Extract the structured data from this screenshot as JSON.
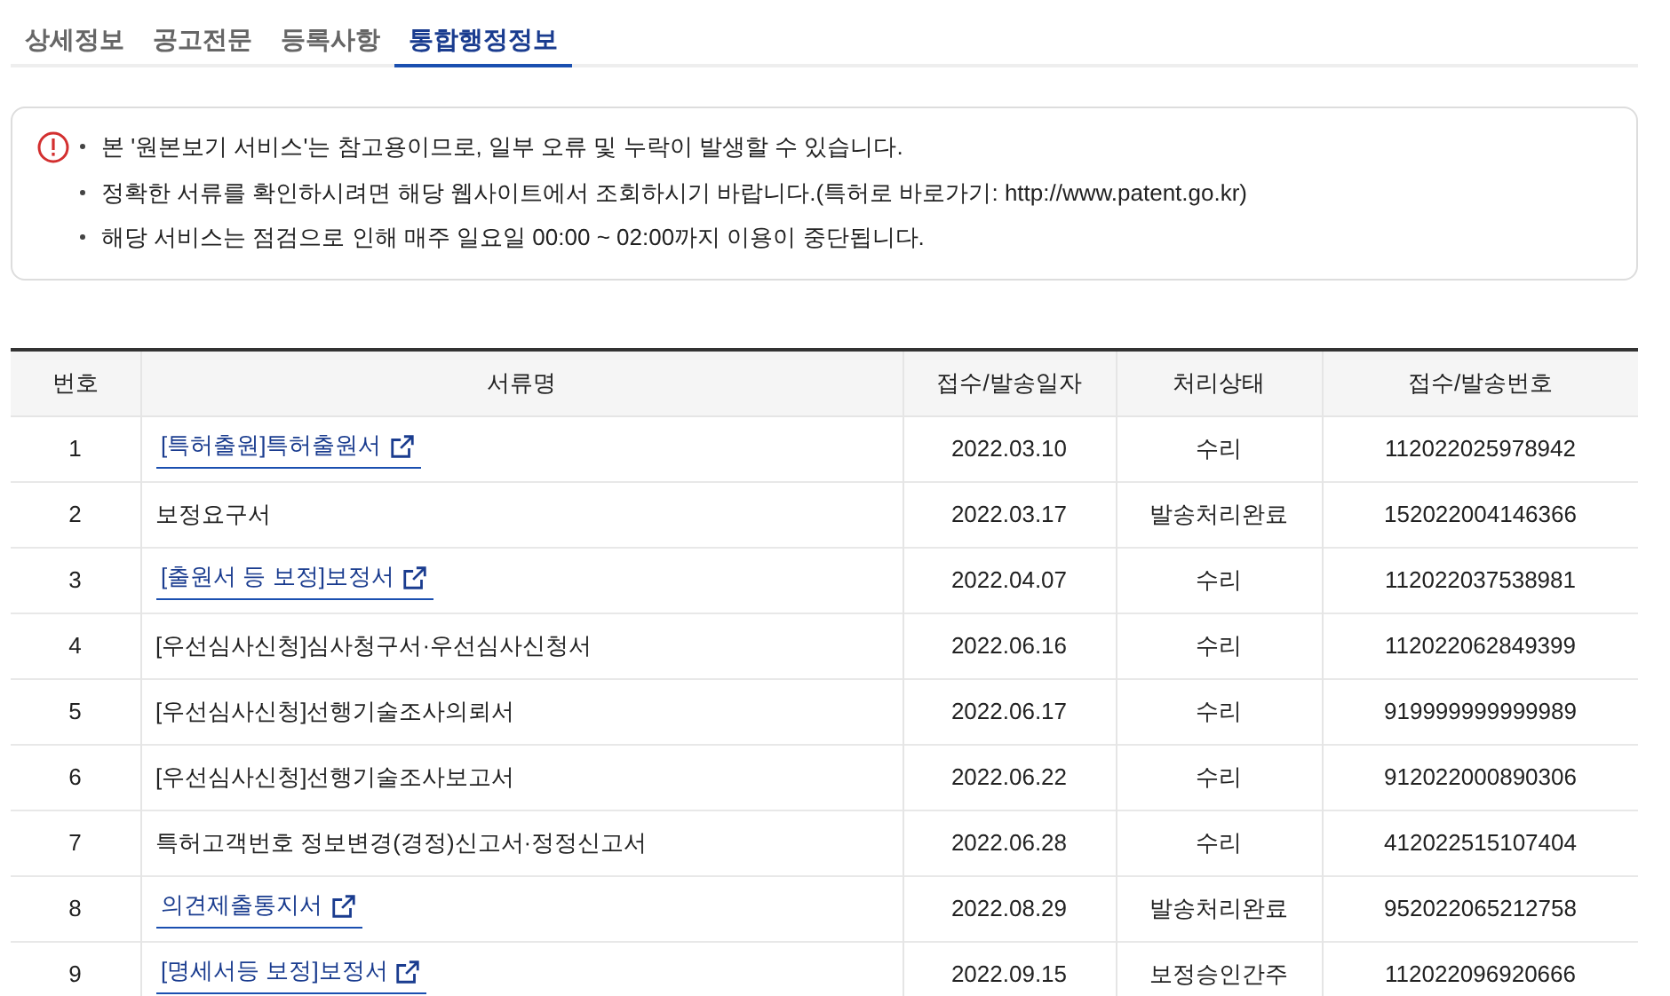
{
  "tabs": [
    {
      "label": "상세정보",
      "selected": false
    },
    {
      "label": "공고전문",
      "selected": false
    },
    {
      "label": "등록사항",
      "selected": false
    },
    {
      "label": "통합행정정보",
      "selected": true
    }
  ],
  "notice": {
    "lines": [
      "본 '원본보기 서비스'는 참고용이므로, 일부 오류 및 누락이 발생할 수 있습니다.",
      "정확한 서류를 확인하시려면 해당 웹사이트에서 조회하시기 바랍니다.(특허로 바로가기: http://www.patent.go.kr)",
      "해당 서비스는 점검으로 인해 매주 일요일 00:00 ~ 02:00까지 이용이 중단됩니다."
    ]
  },
  "table": {
    "columns": [
      "번호",
      "서류명",
      "접수/발송일자",
      "처리상태",
      "접수/발송번호"
    ],
    "rows": [
      {
        "no": "1",
        "name": "[특허출원]특허출원서",
        "link": true,
        "date": "2022.03.10",
        "status": "수리",
        "number": "112022025978942"
      },
      {
        "no": "2",
        "name": "보정요구서",
        "link": false,
        "date": "2022.03.17",
        "status": "발송처리완료",
        "number": "152022004146366"
      },
      {
        "no": "3",
        "name": "[출원서 등 보정]보정서",
        "link": true,
        "date": "2022.04.07",
        "status": "수리",
        "number": "112022037538981"
      },
      {
        "no": "4",
        "name": "[우선심사신청]심사청구서·우선심사신청서",
        "link": false,
        "date": "2022.06.16",
        "status": "수리",
        "number": "112022062849399"
      },
      {
        "no": "5",
        "name": "[우선심사신청]선행기술조사의뢰서",
        "link": false,
        "date": "2022.06.17",
        "status": "수리",
        "number": "919999999999989"
      },
      {
        "no": "6",
        "name": "[우선심사신청]선행기술조사보고서",
        "link": false,
        "date": "2022.06.22",
        "status": "수리",
        "number": "912022000890306"
      },
      {
        "no": "7",
        "name": "특허고객번호 정보변경(경정)신고서·정정신고서",
        "link": false,
        "date": "2022.06.28",
        "status": "수리",
        "number": "412022515107404"
      },
      {
        "no": "8",
        "name": "의견제출통지서",
        "link": true,
        "date": "2022.08.29",
        "status": "발송처리완료",
        "number": "952022065212758"
      },
      {
        "no": "9",
        "name": "[명세서등 보정]보정서",
        "link": true,
        "date": "2022.09.15",
        "status": "보정승인간주",
        "number": "112022096920666"
      }
    ]
  }
}
